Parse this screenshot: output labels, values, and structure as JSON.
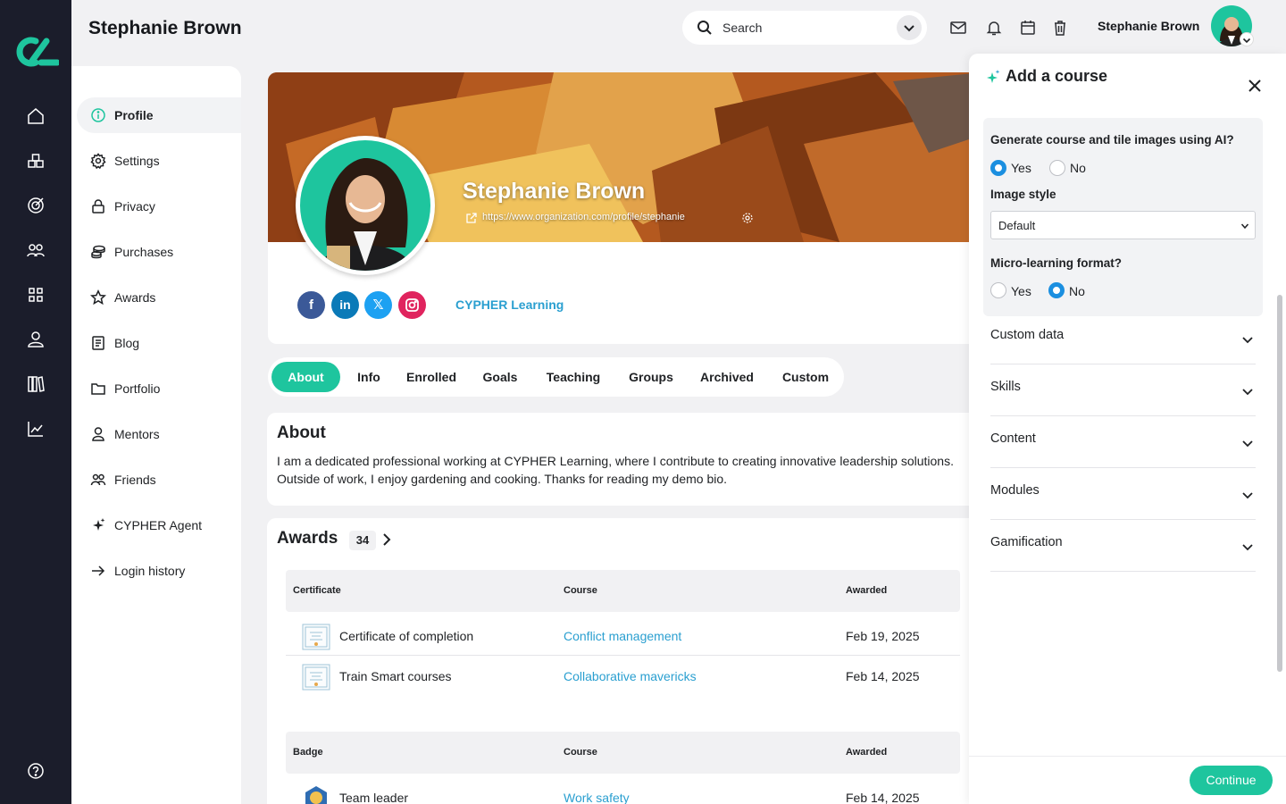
{
  "header": {
    "title": "Stephanie Brown",
    "search_placeholder": "Search",
    "user_name": "Stephanie Brown"
  },
  "rail": {
    "icons": [
      "home-icon",
      "catalog-icon",
      "goals-icon",
      "groups-icon",
      "apps-icon",
      "user-icon",
      "library-icon",
      "analytics-icon",
      "help-icon"
    ]
  },
  "subnav": {
    "items": [
      {
        "label": "Profile",
        "icon": "info-icon",
        "active": true
      },
      {
        "label": "Settings",
        "icon": "gear-icon"
      },
      {
        "label": "Privacy",
        "icon": "lock-icon"
      },
      {
        "label": "Purchases",
        "icon": "coins-icon"
      },
      {
        "label": "Awards",
        "icon": "star-icon"
      },
      {
        "label": "Blog",
        "icon": "blog-icon"
      },
      {
        "label": "Portfolio",
        "icon": "folder-icon"
      },
      {
        "label": "Mentors",
        "icon": "mentor-icon"
      },
      {
        "label": "Friends",
        "icon": "friends-icon"
      },
      {
        "label": "CYPHER Agent",
        "icon": "sparkle-icon"
      },
      {
        "label": "Login history",
        "icon": "arrow-right-icon"
      }
    ]
  },
  "profile": {
    "name": "Stephanie Brown",
    "url": "https://www.organization.com/profile/stephanie",
    "organization": "CYPHER Learning",
    "social": [
      "facebook",
      "linkedin",
      "x",
      "instagram"
    ],
    "colors": {
      "facebook": "#3b5998",
      "linkedin": "#0b7ab8",
      "x": "#1da1f2",
      "instagram": "#e0245e",
      "accent": "#1ec59e",
      "link": "#2a9fd0"
    }
  },
  "tabs": [
    {
      "label": "About",
      "active": true
    },
    {
      "label": "Info"
    },
    {
      "label": "Enrolled"
    },
    {
      "label": "Goals"
    },
    {
      "label": "Teaching"
    },
    {
      "label": "Groups"
    },
    {
      "label": "Archived"
    },
    {
      "label": "Custom"
    }
  ],
  "about": {
    "title": "About",
    "text": "I am a dedicated professional working at CYPHER Learning, where I contribute to creating innovative leadership solutions. Outside of work, I enjoy gardening and cooking. Thanks for reading my demo bio."
  },
  "awards": {
    "title": "Awards",
    "count": "34",
    "certificates": {
      "headers": [
        "Certificate",
        "Course",
        "Awarded"
      ],
      "rows": [
        {
          "name": "Certificate of completion",
          "course": "Conflict management",
          "awarded": "Feb 19, 2025"
        },
        {
          "name": "Train Smart courses",
          "course": "Collaborative mavericks",
          "awarded": "Feb 14, 2025"
        }
      ]
    },
    "badges": {
      "headers": [
        "Badge",
        "Course",
        "Awarded"
      ],
      "rows": [
        {
          "name": "Team leader",
          "course": "Work safety",
          "awarded": "Feb 14, 2025"
        }
      ]
    }
  },
  "panel": {
    "title": "Add a course",
    "ai_question": "Generate course and tile images using AI?",
    "ai_yes": "Yes",
    "ai_no": "No",
    "ai_selected": "Yes",
    "image_style_label": "Image style",
    "image_style_value": "Default",
    "micro_question": "Micro-learning format?",
    "micro_yes": "Yes",
    "micro_no": "No",
    "micro_selected": "No",
    "sections": [
      "Custom data",
      "Skills",
      "Content",
      "Modules",
      "Gamification"
    ],
    "continue_label": "Continue"
  }
}
